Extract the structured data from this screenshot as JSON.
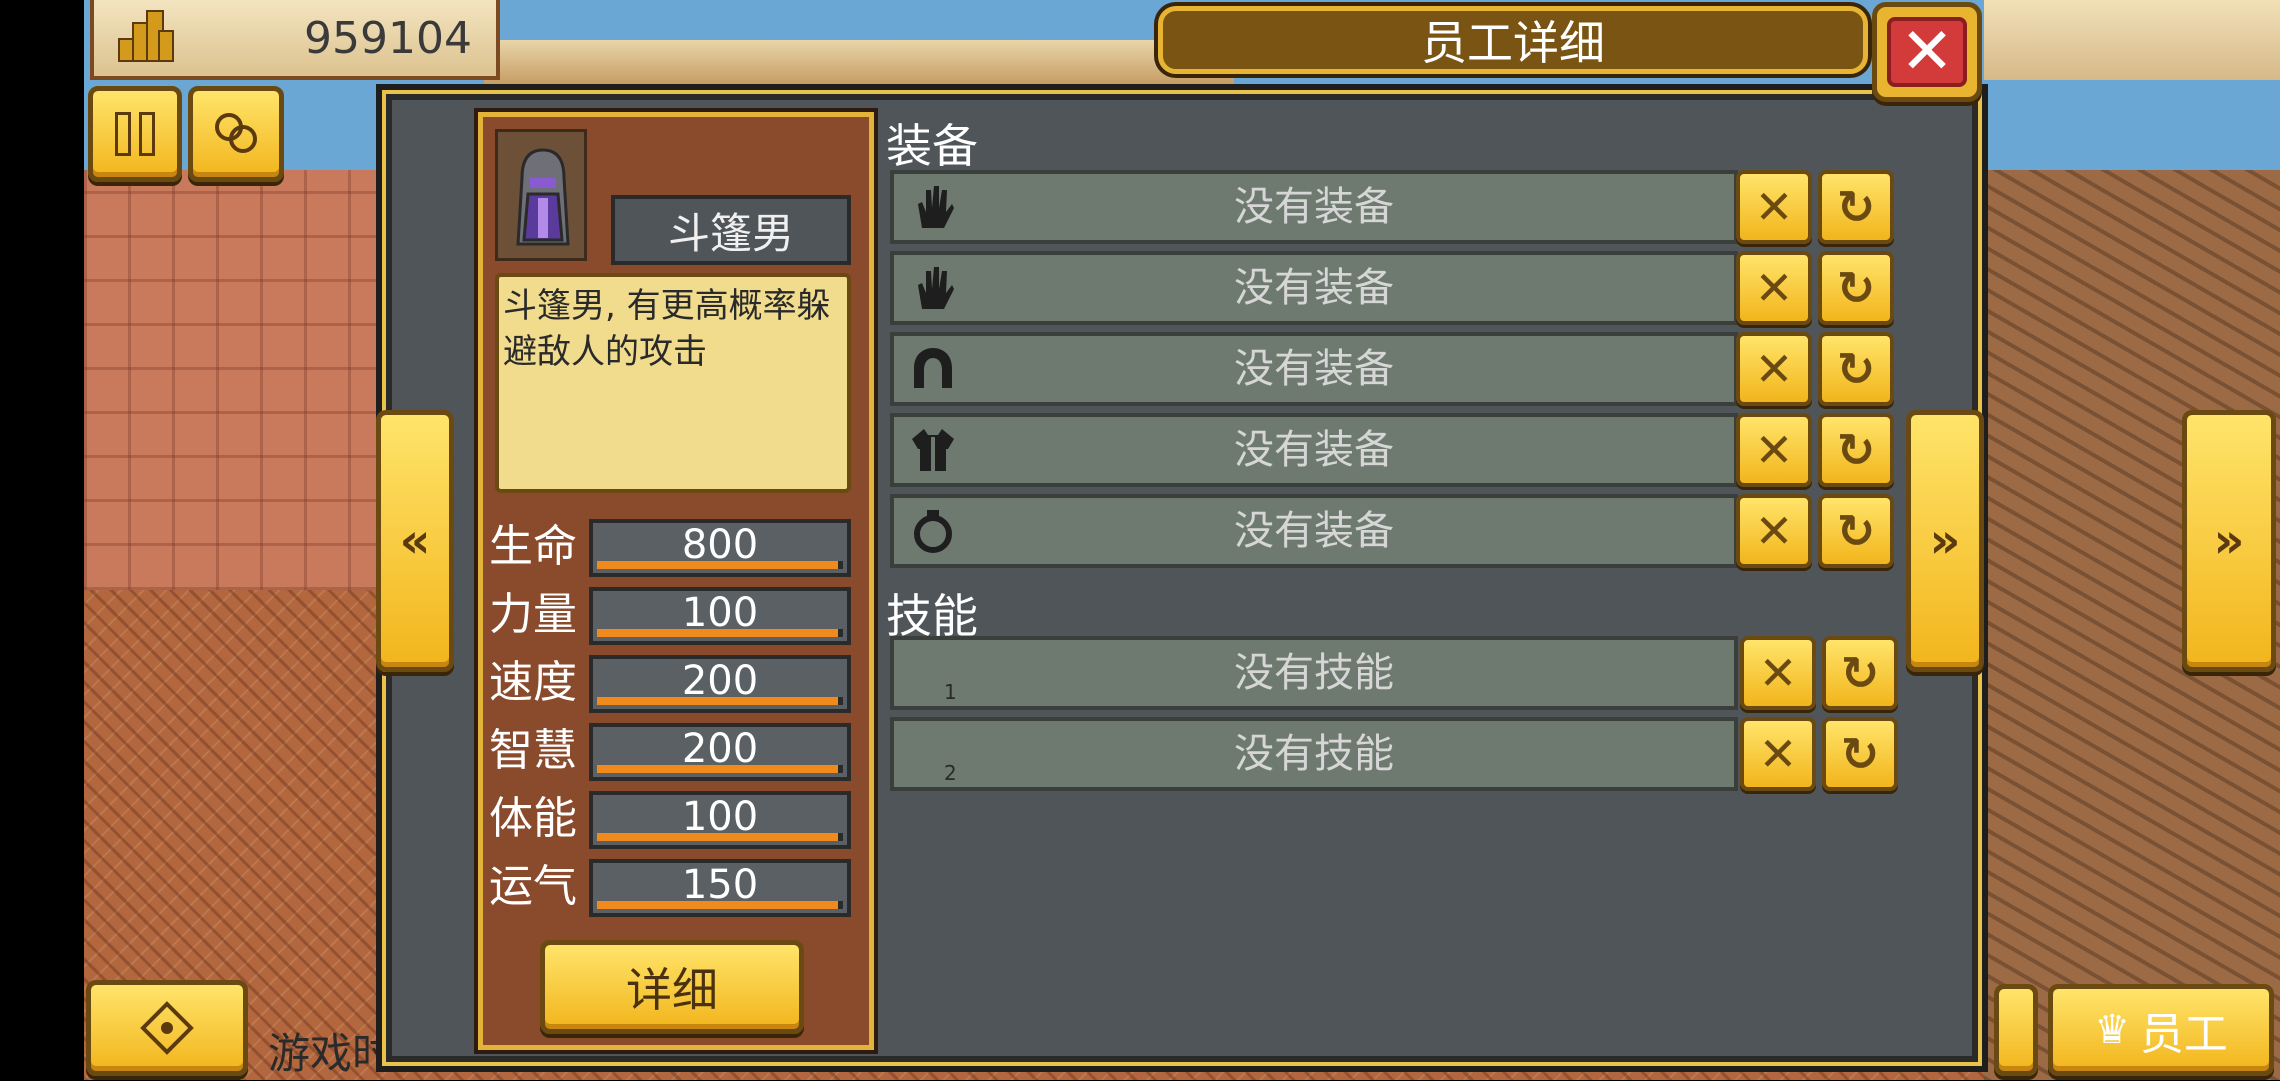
{
  "hud": {
    "money": "959104",
    "bottom_left_text": "游戏时",
    "staff_label": "员工"
  },
  "dialog": {
    "title": "员工详细",
    "close_glyph": "✕"
  },
  "character": {
    "name": "斗篷男",
    "description": "斗篷男, 有更高概率躲避敌人的攻击",
    "detail_button": "详细",
    "stats": [
      {
        "label": "生命",
        "value": "800",
        "fill": 0.98
      },
      {
        "label": "力量",
        "value": "100",
        "fill": 0.98
      },
      {
        "label": "速度",
        "value": "200",
        "fill": 0.98
      },
      {
        "label": "智慧",
        "value": "200",
        "fill": 0.98
      },
      {
        "label": "体能",
        "value": "100",
        "fill": 0.98
      },
      {
        "label": "运气",
        "value": "150",
        "fill": 0.98
      }
    ]
  },
  "equipment": {
    "title": "装备",
    "slots": [
      {
        "icon": "glove-icon",
        "text": "没有装备"
      },
      {
        "icon": "glove-icon",
        "text": "没有装备"
      },
      {
        "icon": "helmet-icon",
        "text": "没有装备"
      },
      {
        "icon": "armor-icon",
        "text": "没有装备"
      },
      {
        "icon": "ring-icon",
        "text": "没有装备"
      }
    ]
  },
  "skills": {
    "title": "技能",
    "slots": [
      {
        "index": "1",
        "text": "没有技能"
      },
      {
        "index": "2",
        "text": "没有技能"
      }
    ]
  },
  "colors": {
    "accent_gold": "#f2b51c",
    "panel_gray": "#4f5558",
    "card_brown": "#8a4a2c",
    "close_red": "#d33a3a",
    "stat_bar": "#f08a1c"
  }
}
